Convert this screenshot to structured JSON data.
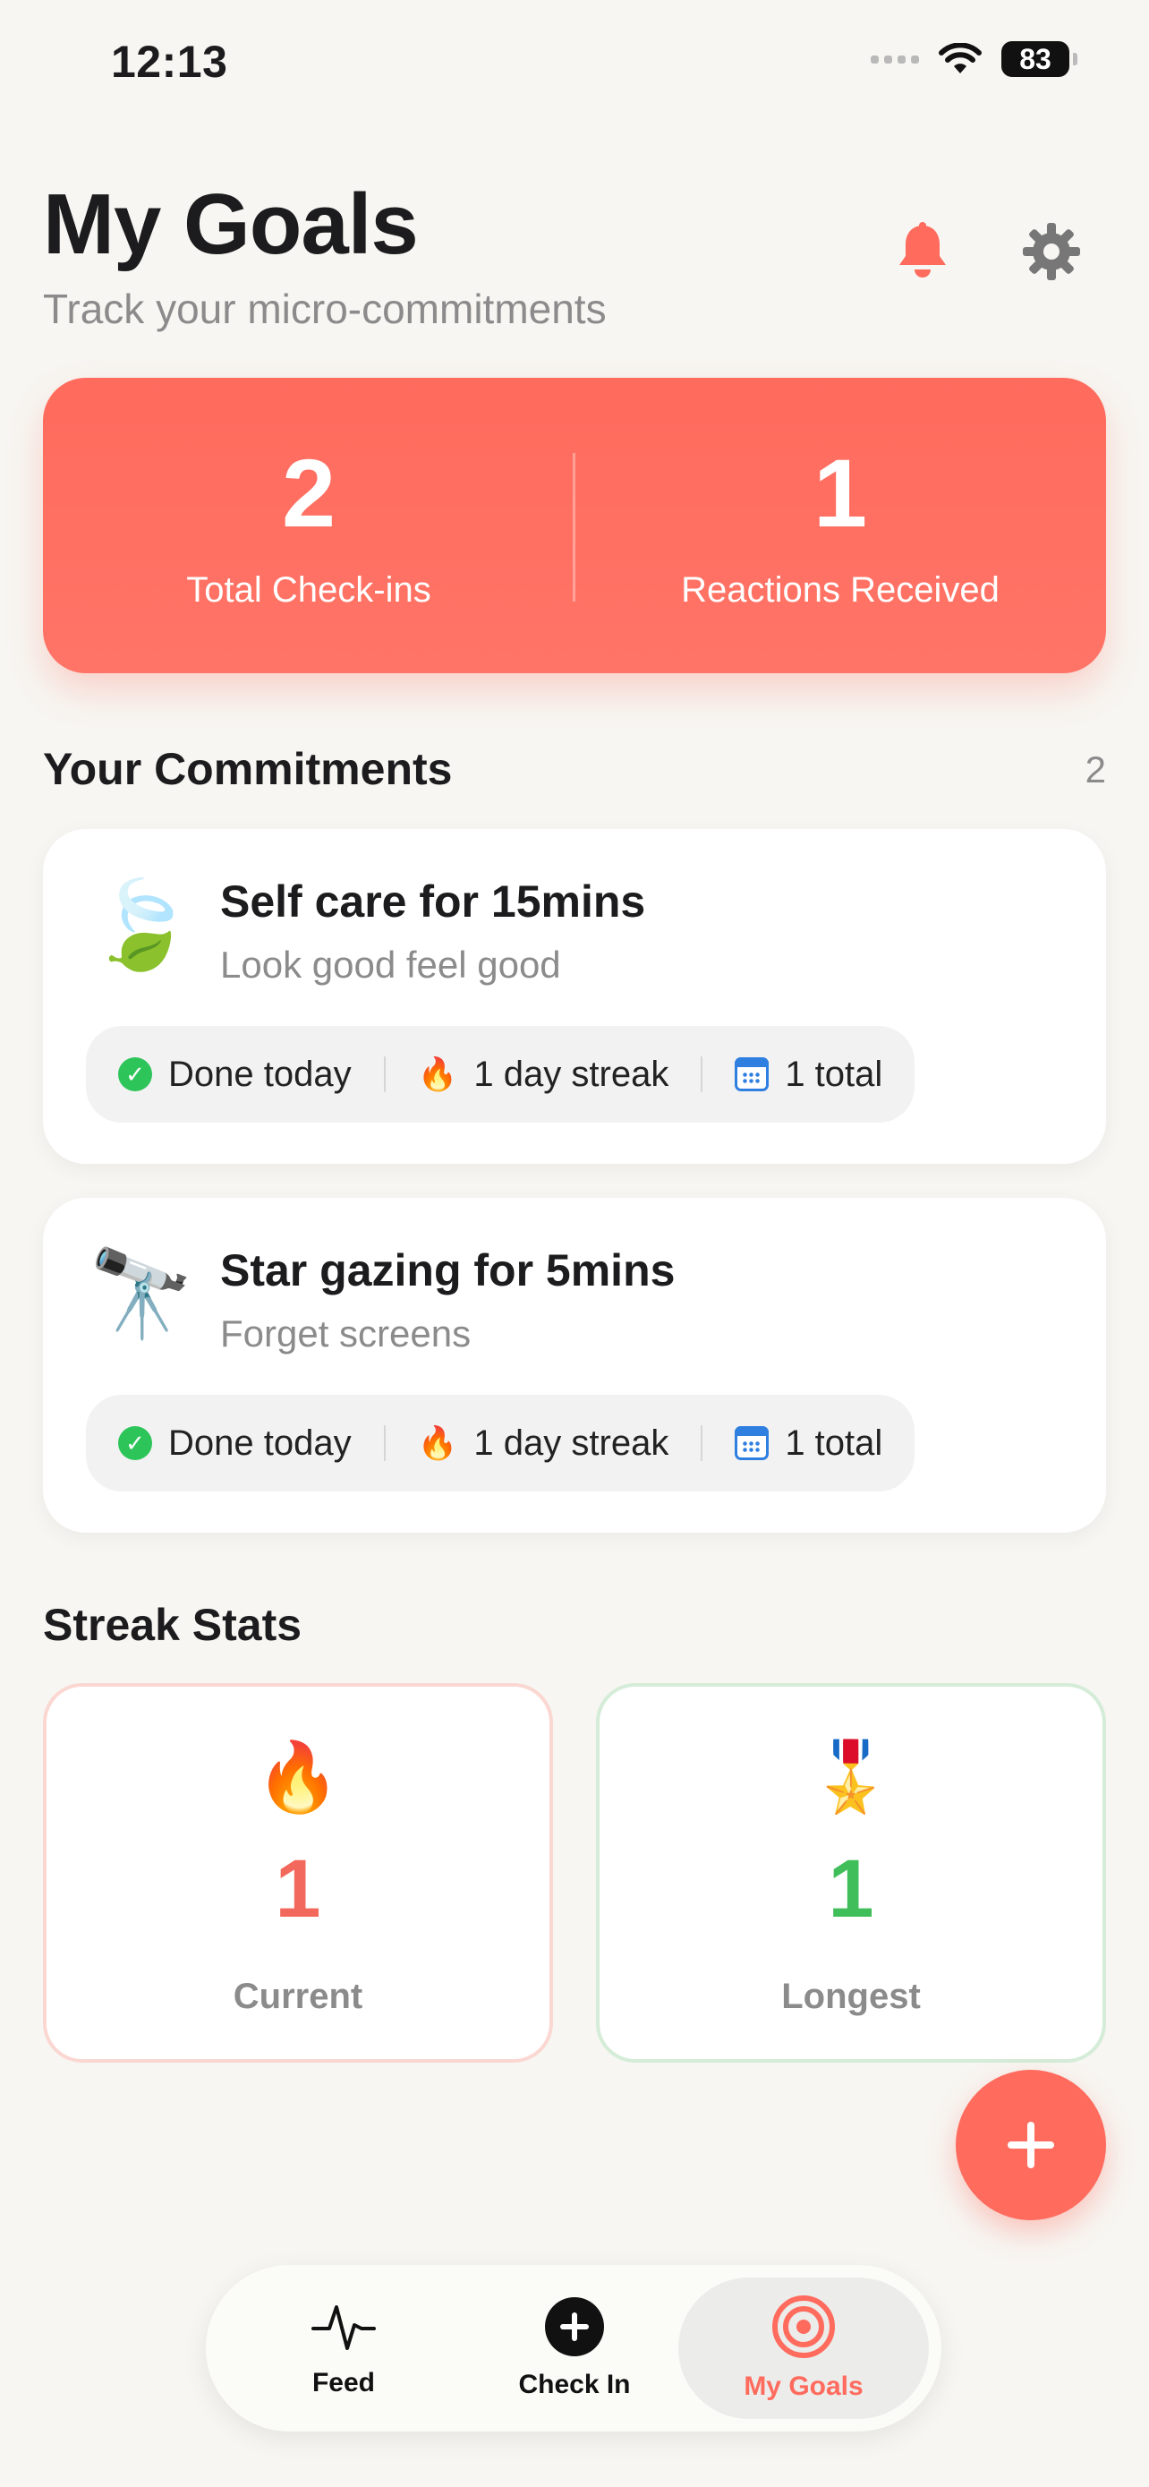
{
  "status": {
    "time": "12:13",
    "battery": "83"
  },
  "header": {
    "title": "My Goals",
    "subtitle": "Track your micro-commitments"
  },
  "summary": [
    {
      "value": "2",
      "label": "Total Check-ins"
    },
    {
      "value": "1",
      "label": "Reactions Received"
    }
  ],
  "commitments_section": {
    "title": "Your Commitments",
    "count": "2"
  },
  "commitments": [
    {
      "emoji": "🍃",
      "title": "Self care for 15mins",
      "subtitle": "Look good feel good",
      "status": "Done today",
      "streak": "1 day streak",
      "total": "1 total"
    },
    {
      "emoji": "🔭",
      "title": "Star gazing for 5mins",
      "subtitle": "Forget screens",
      "status": "Done today",
      "streak": "1 day streak",
      "total": "1 total"
    }
  ],
  "streak_section": {
    "title": "Streak Stats"
  },
  "streaks": {
    "current": {
      "emoji": "🔥",
      "value": "1",
      "label": "Current",
      "color": "#f2685c"
    },
    "longest": {
      "emoji": "🎖️",
      "value": "1",
      "label": "Longest",
      "color": "#3fbe5a"
    }
  },
  "tabs": [
    {
      "label": "Feed",
      "icon": "pulse-icon"
    },
    {
      "label": "Check In",
      "icon": "plus-circle-icon"
    },
    {
      "label": "My Goals",
      "icon": "target-icon",
      "active": true
    }
  ],
  "colors": {
    "accent": "#ff6b5d",
    "background": "#f7f6f2",
    "success": "#2dc55a"
  }
}
